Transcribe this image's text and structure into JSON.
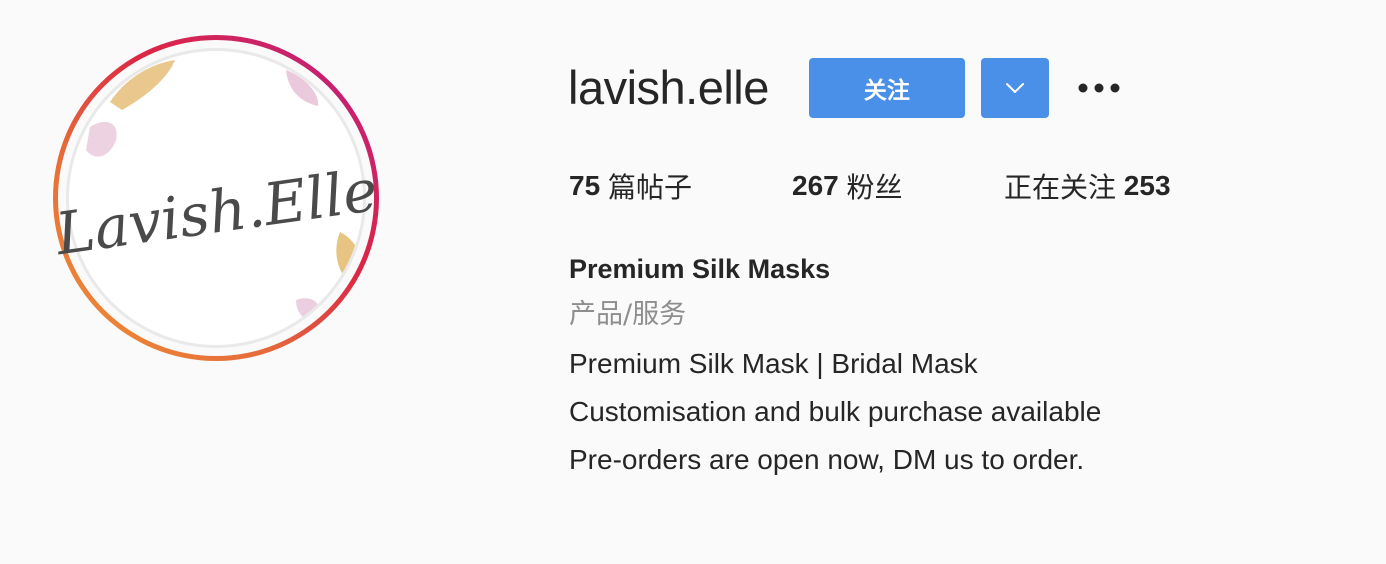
{
  "profile": {
    "username": "lavish.elle",
    "follow_label": "关注",
    "avatar_logo_text": "Lavish.Elle"
  },
  "icons": {
    "dropdown": "chevron-down-icon",
    "more": "more-horizontal-icon"
  },
  "stats": {
    "posts_count": "75",
    "posts_label": "篇帖子",
    "followers_count": "267",
    "followers_label": "粉丝",
    "following_label": "正在关注",
    "following_count": "253"
  },
  "bio": {
    "name": "Premium Silk Masks",
    "category": "产品/服务",
    "lines": [
      "Premium Silk Mask | Bridal Mask",
      "Customisation and bulk purchase available",
      "Pre-orders are open now, DM us to order."
    ]
  },
  "colors": {
    "background": "#fafafa",
    "button_blue": "#4a90e8",
    "text_primary": "#262626",
    "text_secondary": "#8e8e8e",
    "story_ring_start": "#f09433",
    "story_ring_end": "#bc1888"
  }
}
